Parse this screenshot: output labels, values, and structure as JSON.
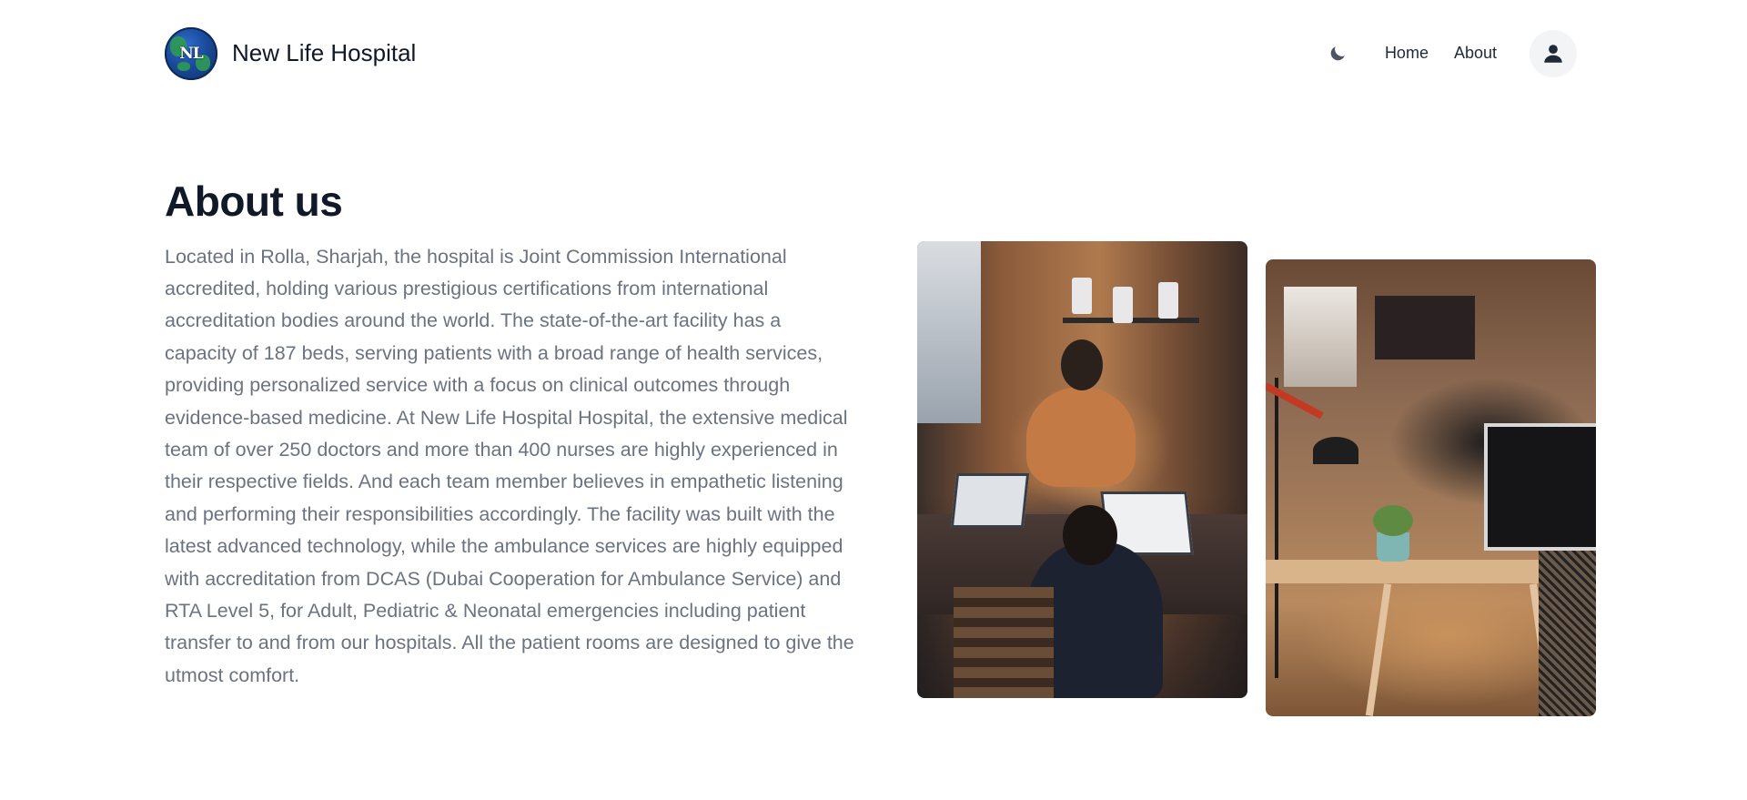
{
  "header": {
    "logo_letters": "NL",
    "brand_name": "New Life Hospital",
    "nav": {
      "theme_toggle_icon": "moon-icon",
      "links": [
        {
          "label": "Home"
        },
        {
          "label": "About"
        }
      ],
      "avatar_icon": "user-icon"
    }
  },
  "main": {
    "title": "About us",
    "body": "Located in Rolla, Sharjah, the hospital is Joint Commission International accredited, holding various prestigious certifications from international accreditation bodies around the world. The state-of-the-art facility has a capacity of 187 beds, serving patients with a broad range of health services, providing personalized service with a focus on clinical outcomes through evidence-based medicine. At New Life Hospital Hospital, the extensive medical team of over 250 doctors and more than 400 nurses are highly experienced in their respective fields. And each team member believes in empathetic listening and performing their responsibilities accordingly. The facility was built with the latest advanced technology, while the ambulance services are highly equipped with accreditation from DCAS (Dubai Cooperation for Ambulance Service) and RTA Level 5, for Adult, Pediatric & Neonatal emergencies including patient transfer to and from our hospitals. All the patient rooms are designed to give the utmost comfort."
  },
  "gallery": {
    "photos": [
      {
        "subject": "team-working-at-table"
      },
      {
        "subject": "office-workspace"
      }
    ]
  },
  "colors": {
    "text_primary": "#111827",
    "text_muted": "#6b7280",
    "avatar_bg": "#f3f4f6"
  }
}
